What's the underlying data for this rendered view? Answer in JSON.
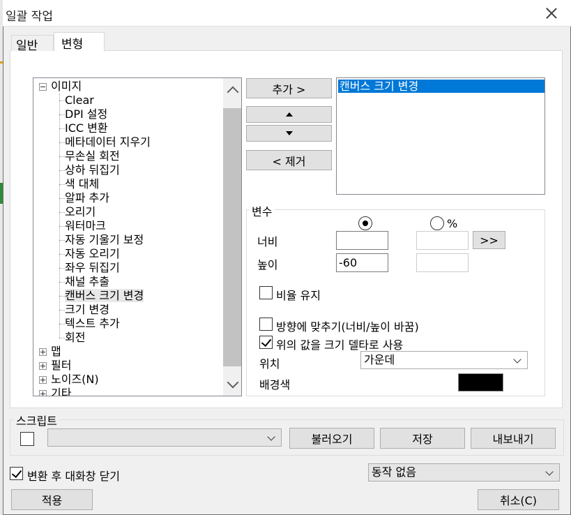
{
  "window": {
    "title": "일괄 작업"
  },
  "tabs": [
    {
      "label": "일반",
      "active": false
    },
    {
      "label": "변형",
      "active": true
    }
  ],
  "tree": {
    "root": "이미지",
    "children": [
      "Clear",
      "DPI 설정",
      "ICC 변환",
      "메타데이터 지우기",
      "무손실 회전",
      "상하 뒤집기",
      "색 대체",
      "알파 추가",
      "오리기",
      "워터마크",
      "자동 기울기 보정",
      "자동 오리기",
      "좌우 뒤집기",
      "채널 추출",
      "캔버스 크기 변경",
      "크기 변경",
      "텍스트 추가",
      "회전"
    ],
    "selected": "캔버스 크기 변경",
    "collapsed_groups": [
      "맵",
      "필터",
      "노이즈(N)",
      "기타"
    ]
  },
  "buttons": {
    "add": "추가 >",
    "move_up": "up-triangle",
    "move_down": "down-triangle",
    "remove": "< 제거",
    "swap": ">>",
    "load": "불러오기",
    "save": "저장",
    "export": "내보내기",
    "apply": "적용",
    "cancel": "취소(C)"
  },
  "task_list": {
    "items": [
      "캔버스 크기 변경"
    ],
    "selected_index": 0
  },
  "params": {
    "group_label": "변수",
    "unit_px_selected": true,
    "percent_label": "%",
    "width_label": "너비",
    "width_value": "",
    "height_label": "높이",
    "height_value": "-60",
    "keep_ratio_label": "비율 유지",
    "keep_ratio": false,
    "fit_orientation_label": "방향에 맞추기(너비/높이 바꿈)",
    "fit_orientation": false,
    "use_delta_label": "위의 값을 크기 델타로 사용",
    "use_delta": true,
    "position_label": "위치",
    "position_value": "가운데",
    "bg_color_label": "배경색",
    "bg_color": "#000000"
  },
  "script": {
    "group_label": "스크립트",
    "enabled": false,
    "selected": ""
  },
  "footer": {
    "close_after_label": "변환 후 대화창 닫기",
    "close_after": true,
    "action_value": "동작 없음"
  },
  "colors": {
    "selection": "#0078d7",
    "dialog_bg": "#f0f0f0"
  }
}
